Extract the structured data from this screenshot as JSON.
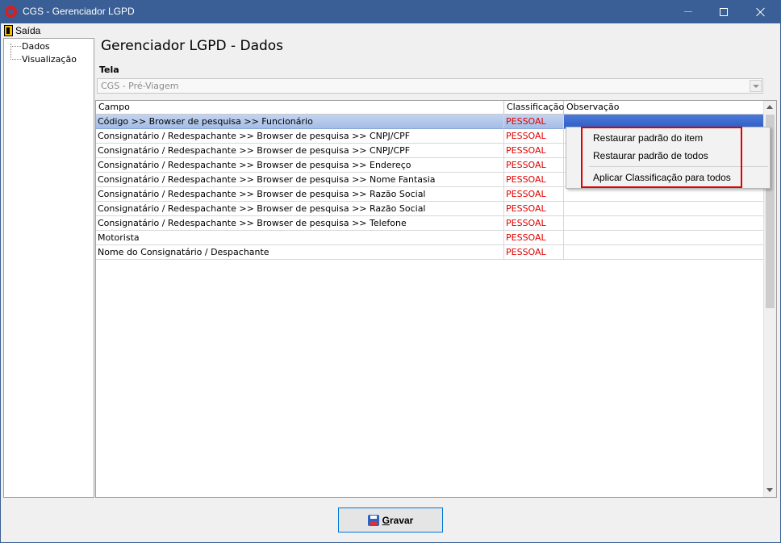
{
  "window": {
    "title": "CGS - Gerenciador LGPD"
  },
  "menu": {
    "exit_label": "Saída"
  },
  "tree": {
    "items": [
      "Dados",
      "Visualização"
    ]
  },
  "page": {
    "title": "Gerenciador LGPD - Dados",
    "tela_label": "Tela",
    "tela_value": "CGS - Pré-Viagem"
  },
  "grid": {
    "columns": [
      "Campo",
      "Classificação",
      "Observação"
    ],
    "rows": [
      {
        "campo": "Código >> Browser de pesquisa >> Funcionário",
        "classificacao": "PESSOAL",
        "observacao": ""
      },
      {
        "campo": "Consignatário / Redespachante >> Browser de pesquisa >> CNPJ/CPF",
        "classificacao": "PESSOAL",
        "observacao": ""
      },
      {
        "campo": "Consignatário / Redespachante >> Browser de pesquisa >> CNPJ/CPF",
        "classificacao": "PESSOAL",
        "observacao": ""
      },
      {
        "campo": "Consignatário / Redespachante >> Browser de pesquisa >> Endereço",
        "classificacao": "PESSOAL",
        "observacao": ""
      },
      {
        "campo": "Consignatário / Redespachante >> Browser de pesquisa >> Nome Fantasia",
        "classificacao": "PESSOAL",
        "observacao": ""
      },
      {
        "campo": "Consignatário / Redespachante >> Browser de pesquisa >> Razão Social",
        "classificacao": "PESSOAL",
        "observacao": ""
      },
      {
        "campo": "Consignatário / Redespachante >> Browser de pesquisa >> Razão Social",
        "classificacao": "PESSOAL",
        "observacao": ""
      },
      {
        "campo": "Consignatário / Redespachante >> Browser de pesquisa >> Telefone",
        "classificacao": "PESSOAL",
        "observacao": ""
      },
      {
        "campo": "Motorista",
        "classificacao": "PESSOAL",
        "observacao": ""
      },
      {
        "campo": "Nome do Consignatário / Despachante",
        "classificacao": "PESSOAL",
        "observacao": ""
      }
    ],
    "selected_row": 0
  },
  "context_menu": {
    "items": [
      "Restaurar padrão do item",
      "Restaurar padrão de todos",
      "Aplicar Classificação para todos"
    ]
  },
  "footer": {
    "save_label": "Gravar"
  },
  "colors": {
    "titlebar": "#3a5f96",
    "classification_text": "#e00000",
    "highlight_border": "#e00000"
  }
}
